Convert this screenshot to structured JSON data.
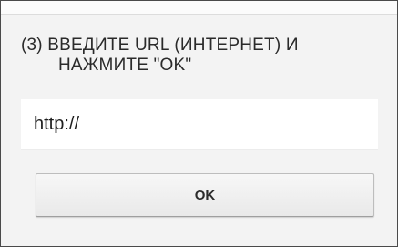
{
  "dialog": {
    "instruction_line1": "(3) ВВЕДИТЕ URL (ИНТЕРНЕТ) И",
    "instruction_line2": "НАЖМИТЕ \"OK\"",
    "url_input": {
      "value": "http://",
      "placeholder": ""
    },
    "ok_label": "OK"
  },
  "colors": {
    "dialog_background": "#f3f3f3",
    "border": "#4a4a4a",
    "input_background": "#ffffff",
    "text": "#2a2a2a"
  }
}
